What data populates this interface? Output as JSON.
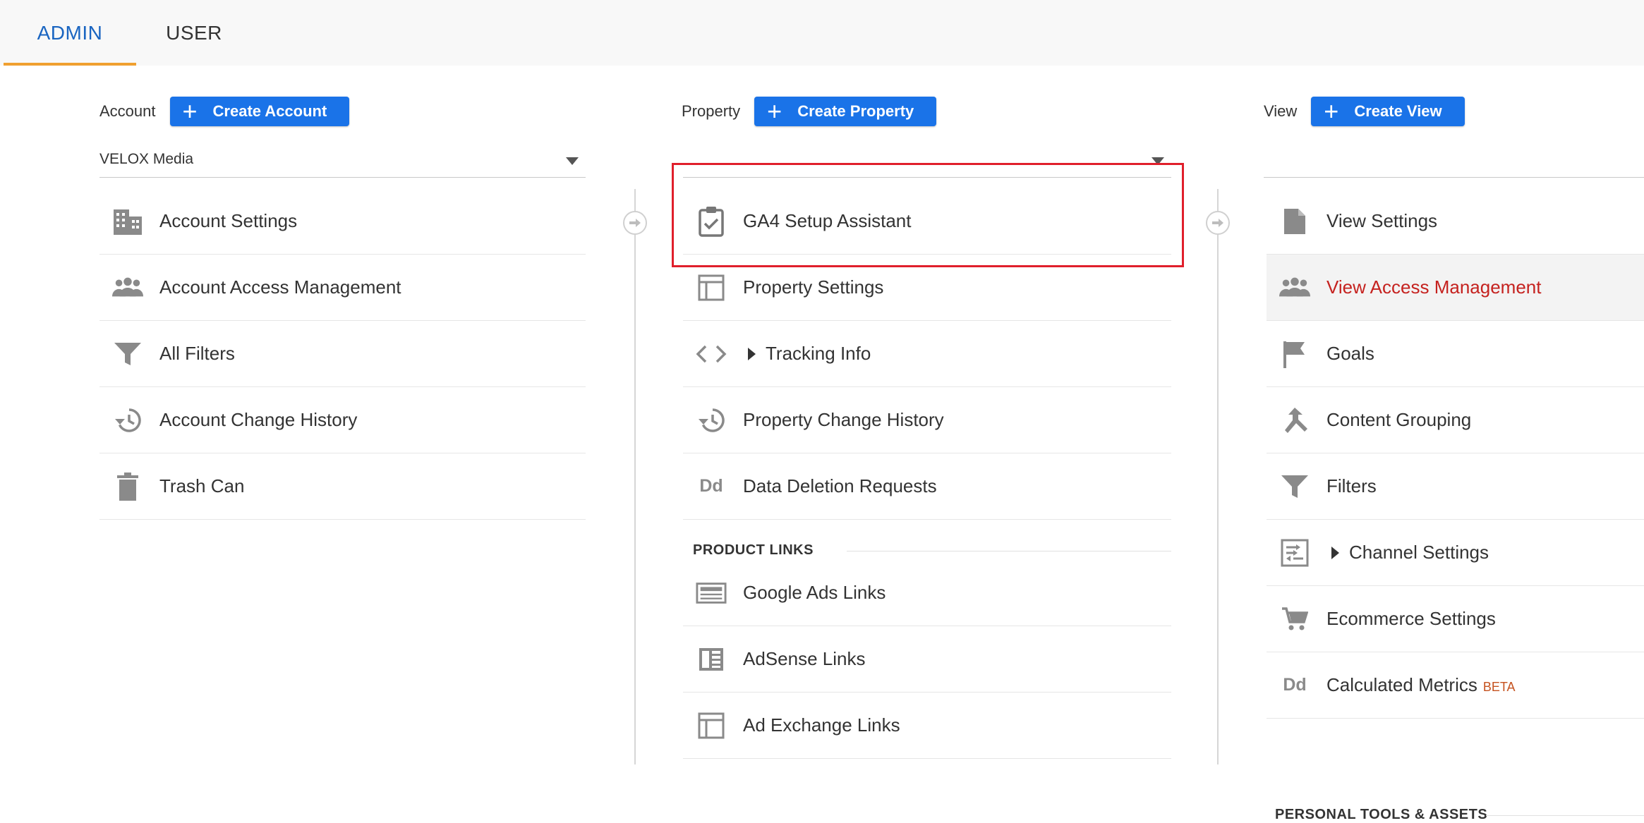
{
  "tabs": [
    {
      "label": "ADMIN",
      "active": true
    },
    {
      "label": "USER",
      "active": false
    }
  ],
  "account": {
    "label": "Account",
    "create_label": "Create Account",
    "selected": "VELOX Media",
    "items": [
      {
        "label": "Account Settings",
        "icon": "building-icon"
      },
      {
        "label": "Account Access Management",
        "icon": "people-icon"
      },
      {
        "label": "All Filters",
        "icon": "filter-icon"
      },
      {
        "label": "Account Change History",
        "icon": "history-icon"
      },
      {
        "label": "Trash Can",
        "icon": "trash-icon"
      }
    ]
  },
  "property": {
    "label": "Property",
    "create_label": "Create Property",
    "selected": "",
    "items": [
      {
        "label": "GA4 Setup Assistant",
        "icon": "clipboard-check-icon"
      },
      {
        "label": "Property Settings",
        "icon": "layout-icon"
      },
      {
        "label": "Tracking Info",
        "icon": "code-icon"
      },
      {
        "label": "Property Change History",
        "icon": "history-icon"
      },
      {
        "label": "Data Deletion Requests",
        "icon": "dd-icon",
        "icon_text": "Dd"
      }
    ],
    "product_links_heading": "PRODUCT LINKS",
    "product_links": [
      {
        "label": "Google Ads Links",
        "icon": "ads-icon"
      },
      {
        "label": "AdSense Links",
        "icon": "adsense-icon"
      },
      {
        "label": "Ad Exchange Links",
        "icon": "layout-icon"
      }
    ]
  },
  "view": {
    "label": "View",
    "create_label": "Create View",
    "selected": "",
    "items": [
      {
        "label": "View Settings",
        "icon": "document-icon"
      },
      {
        "label": "View Access Management",
        "icon": "people-icon",
        "active": true
      },
      {
        "label": "Goals",
        "icon": "flag-icon"
      },
      {
        "label": "Content Grouping",
        "icon": "merge-icon"
      },
      {
        "label": "Filters",
        "icon": "filter-icon"
      },
      {
        "label": "Channel Settings",
        "icon": "channel-icon"
      },
      {
        "label": "Ecommerce Settings",
        "icon": "cart-icon"
      },
      {
        "label": "Calculated Metrics",
        "icon": "dd-icon",
        "icon_text": "Dd",
        "badge": "BETA"
      }
    ],
    "personal_heading": "PERSONAL TOOLS & ASSETS"
  },
  "colors": {
    "accent": "#1a73e8",
    "tab_active": "#1a65c1",
    "tab_underline": "#f0a030",
    "active_item": "#c5221f",
    "highlight": "#e01f2b"
  }
}
